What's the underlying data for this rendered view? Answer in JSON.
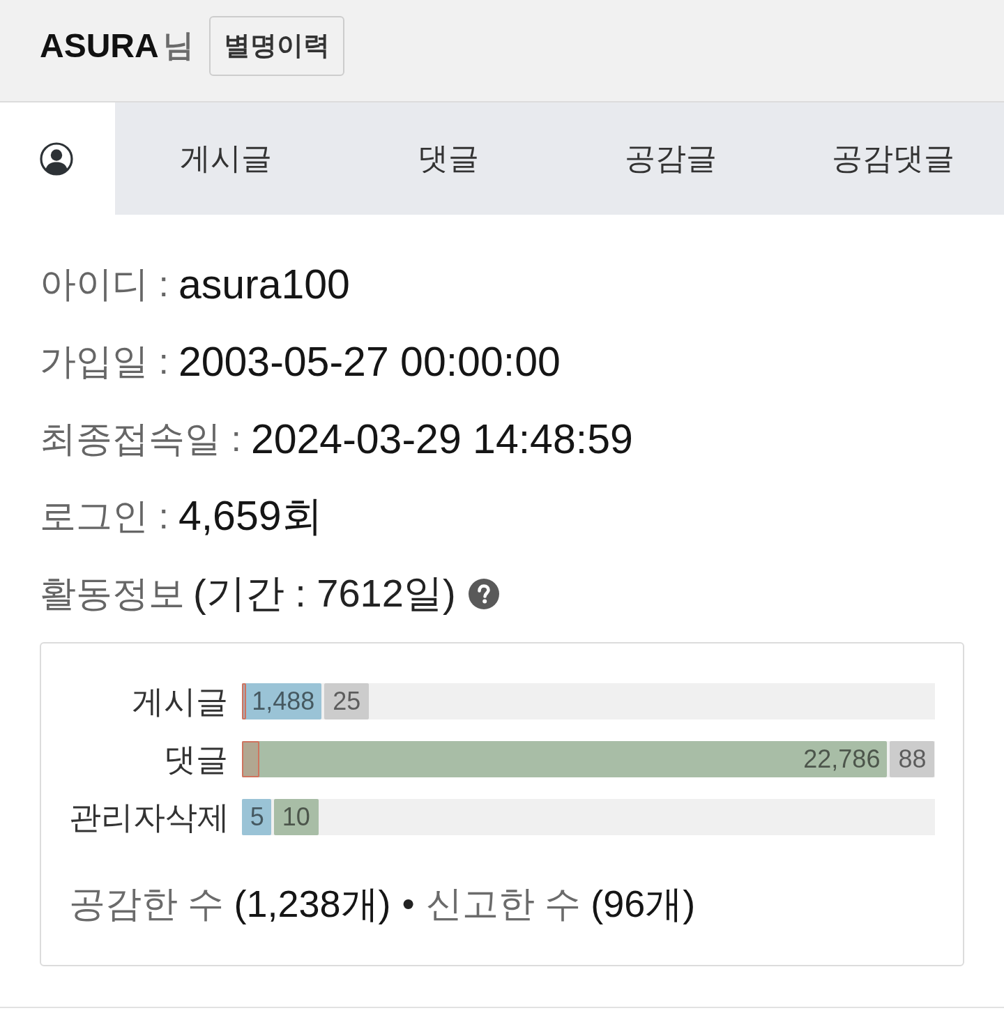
{
  "header": {
    "username": "ASURA",
    "suffix": "님",
    "button": "별명이력"
  },
  "tabs": [
    {
      "kind": "icon",
      "selected": true
    },
    {
      "kind": "text",
      "label": "게시글",
      "selected": false
    },
    {
      "kind": "text",
      "label": "댓글",
      "selected": false
    },
    {
      "kind": "text",
      "label": "공감글",
      "selected": false
    },
    {
      "kind": "text",
      "label": "공감댓글",
      "selected": false
    }
  ],
  "info": [
    {
      "label": "아이디 :",
      "value": "asura100"
    },
    {
      "label": "가입일 :",
      "value": "2003-05-27 00:00:00"
    },
    {
      "label": "최종접속일 :",
      "value": "2024-03-29 14:48:59"
    },
    {
      "label": "로그인 :",
      "value": "4,659회"
    }
  ],
  "activity": {
    "title": "활동정보",
    "period": "(기간 : 7612일)",
    "rows": [
      {
        "label": "게시글",
        "marker": {
          "level": 0.006
        },
        "bar": {
          "text": "1,488",
          "color": "#9ac3d6",
          "level": 0.115
        },
        "extra": {
          "text": "25",
          "color": "#cccccc"
        }
      },
      {
        "label": "댓글",
        "marker": {
          "level": 0.025
        },
        "bar": {
          "text": "22,786",
          "color": "#a8bda6",
          "level": 0.931
        },
        "extra": {
          "text": "88",
          "color": "#cccccc"
        }
      },
      {
        "label": "관리자삭제",
        "bar": {
          "text": "5",
          "color": "#9ac3d6",
          "level": 0.042
        },
        "extra": {
          "text": "10",
          "color": "#a8bda6"
        }
      }
    ],
    "totals": [
      {
        "label": "공감한 수",
        "value": "(1,238개)"
      },
      {
        "label": "신고한 수",
        "value": "(96개)"
      }
    ],
    "separator": "•"
  }
}
